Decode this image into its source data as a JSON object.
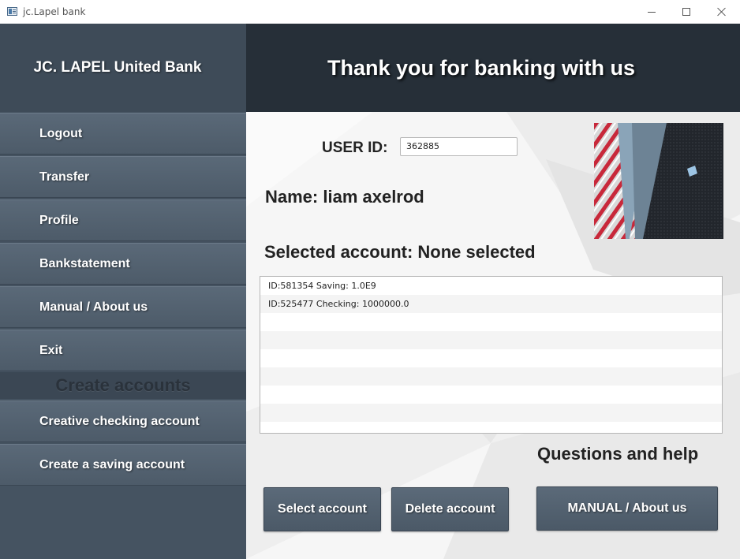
{
  "window": {
    "title": "jc.Lapel bank"
  },
  "sidebar": {
    "brand": "JC. LAPEL United Bank",
    "items": [
      {
        "label": "Logout"
      },
      {
        "label": "Transfer"
      },
      {
        "label": "Profile"
      },
      {
        "label": "Bankstatement"
      },
      {
        "label": "Manual / About us"
      },
      {
        "label": "Exit"
      }
    ],
    "section_header": "Create accounts",
    "create_items": [
      {
        "label": "Creative checking account"
      },
      {
        "label": "Create a saving account"
      }
    ]
  },
  "header": {
    "title": "Thank you for banking with us"
  },
  "main": {
    "user_id_label": "USER ID:",
    "user_id_value": "362885",
    "name_text": "Name: liam axelrod",
    "selected_label": "Selected account:",
    "selected_value": "None selected",
    "accounts": [
      {
        "text": "ID:581354 Saving: 1.0E9"
      },
      {
        "text": "ID:525477 Checking: 1000000.0"
      }
    ],
    "help_title": "Questions and help",
    "buttons": {
      "select": "Select account",
      "delete": "Delete account",
      "manual": "MANUAL / About us"
    }
  },
  "colors": {
    "sidebar_bg": "#455361",
    "header_bg": "#262f38",
    "button_bg": "#55636f"
  }
}
